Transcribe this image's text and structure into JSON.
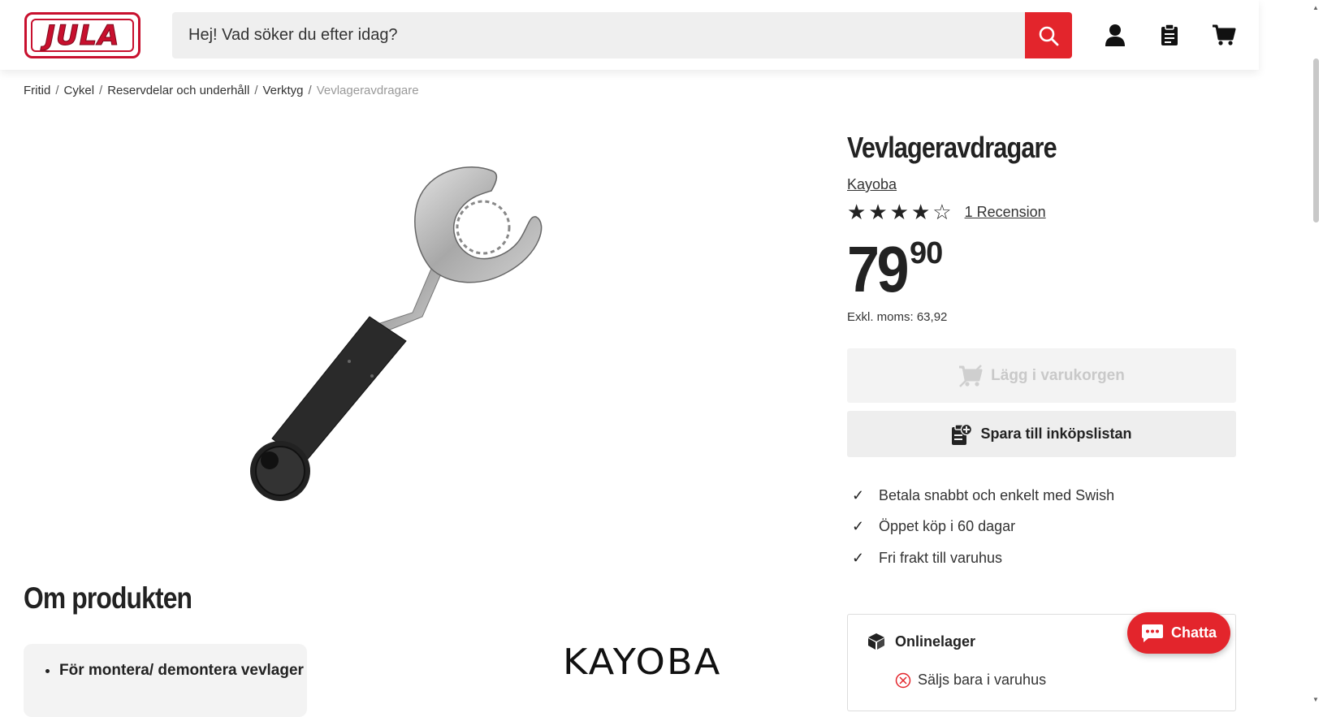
{
  "header": {
    "logo_text": "JULA",
    "search_placeholder": "Hej! Vad söker du efter idag?",
    "icons": [
      "search-icon",
      "user-icon",
      "shopping-list-icon",
      "cart-icon"
    ],
    "accent_color": "#e3252c"
  },
  "breadcrumb": {
    "items": [
      "Fritid",
      "Cykel",
      "Reservdelar och underhåll",
      "Verktyg"
    ],
    "current": "Vevlageravdragare"
  },
  "product": {
    "title": "Vevlageravdragare",
    "brand": "Kayoba",
    "rating": 4,
    "rating_max": 5,
    "reviews_label": "1 Recension",
    "price_main": "79",
    "price_decimals": "90",
    "vat_label": "Exkl. moms: 63,92"
  },
  "actions": {
    "add_to_cart": "Lägg i varukorgen",
    "save_to_list": "Spara till inköpslistan"
  },
  "usps": [
    "Betala snabbt och enkelt med Swish",
    "Öppet köp i 60 dagar",
    "Fri frakt till varuhus"
  ],
  "stock": {
    "title": "Onlinelager",
    "status": "Säljs bara i varuhus"
  },
  "chat": {
    "label": "Chatta"
  },
  "about": {
    "heading": "Om produkten",
    "features": [
      "För montera/ demontera vevlager"
    ],
    "brand_logo": "KAYOBA"
  }
}
